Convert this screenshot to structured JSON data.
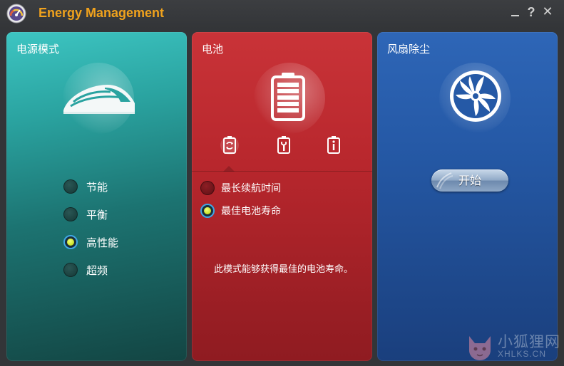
{
  "window": {
    "title": "Energy Management",
    "buttons": {
      "minimize": "",
      "help": "?",
      "close": "✕"
    }
  },
  "power_panel": {
    "title": "电源模式",
    "icon": "train-icon",
    "options": [
      {
        "label": "节能",
        "selected": false
      },
      {
        "label": "平衡",
        "selected": false
      },
      {
        "label": "高性能",
        "selected": true
      },
      {
        "label": "超频",
        "selected": false
      }
    ]
  },
  "battery_panel": {
    "title": "电池",
    "icon": "battery-icon",
    "tabs": [
      {
        "icon": "battery-refresh-icon",
        "active": true
      },
      {
        "icon": "battery-wrench-icon",
        "active": false
      },
      {
        "icon": "battery-info-icon",
        "active": false
      }
    ],
    "options": [
      {
        "label": "最长续航时间",
        "selected": false
      },
      {
        "label": "最佳电池寿命",
        "selected": true
      }
    ],
    "description": "此模式能够获得最佳的电池寿命。"
  },
  "fan_panel": {
    "title": "风扇除尘",
    "icon": "fan-icon",
    "start_label": "开始"
  },
  "watermark": {
    "text_cn": "小狐狸网",
    "text_en": "XHLKS.CN"
  },
  "colors": {
    "title_accent": "#f0a21d",
    "power_panel": "#2aa3a0",
    "battery_panel": "#b8272d",
    "fan_panel": "#2559a6"
  }
}
